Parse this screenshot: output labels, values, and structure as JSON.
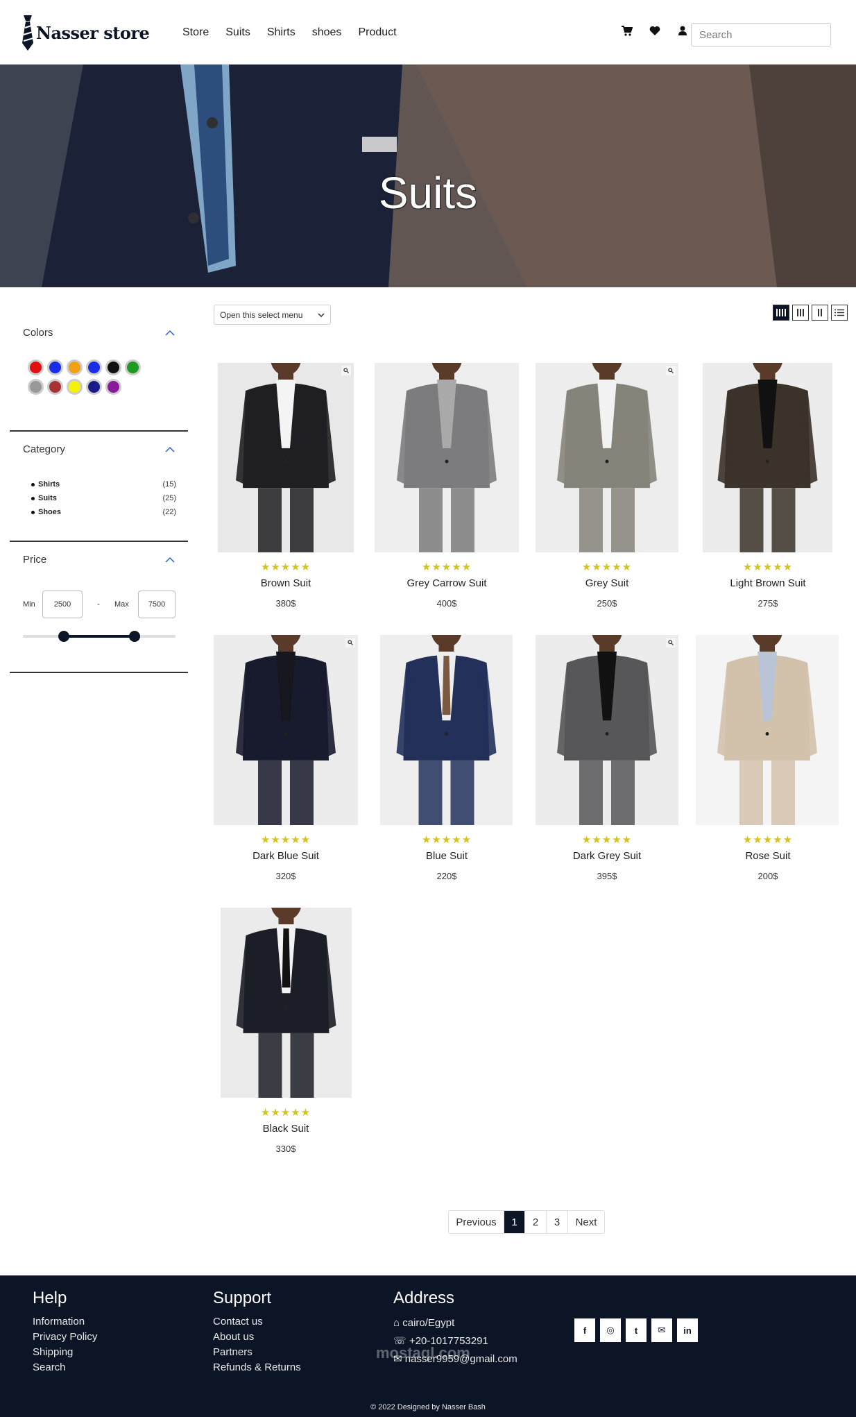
{
  "header": {
    "brand": "Nasser store",
    "nav": [
      "Store",
      "Suits",
      "Shirts",
      "shoes",
      "Product"
    ],
    "search_placeholder": "Search",
    "icons": [
      "cart-icon",
      "heart-icon",
      "user-icon"
    ]
  },
  "hero": {
    "title": "Suits"
  },
  "sidebar": {
    "colors_title": "Colors",
    "colors": [
      "#e01010",
      "#1a2ee8",
      "#f0a010",
      "#1a2ee8",
      "#111111",
      "#1e9a1e",
      "#999999",
      "#a83232",
      "#f4f400",
      "#1a1a8a",
      "#8a1a9a"
    ],
    "category_title": "Category",
    "categories": [
      {
        "name": "Shirts",
        "count": "(15)"
      },
      {
        "name": "Suits",
        "count": "(25)"
      },
      {
        "name": "Shoes",
        "count": "(22)"
      }
    ],
    "price_title": "Price",
    "price": {
      "min_label": "Min",
      "min": "2500",
      "sep": "-",
      "max_label": "Max",
      "max": "7500",
      "slider_low": 0.27,
      "slider_high": 0.73
    }
  },
  "toolbar": {
    "select_label": "Open this select menu"
  },
  "products": [
    {
      "name": "Brown Suit",
      "price": "380$",
      "stars": "★★★★★",
      "suit": "#1f1e22",
      "shirt": "#f4f4f4",
      "tie": "",
      "bg": "#e8e8e8"
    },
    {
      "name": "Grey Carrow Suit",
      "price": "400$",
      "stars": "★★★★★",
      "suit": "#7c7b7d",
      "shirt": "#a9a9a9",
      "tie": "",
      "bg": "#eeeeee"
    },
    {
      "name": "Grey Suit",
      "price": "250$",
      "stars": "★★★★★",
      "suit": "#86837a",
      "shirt": "#f2f2f2",
      "tie": "",
      "bg": "#ededed"
    },
    {
      "name": "Light Brown Suit",
      "price": "275$",
      "stars": "★★★★★",
      "suit": "#3b3229",
      "shirt": "#111111",
      "tie": "",
      "bg": "#ececec"
    },
    {
      "name": "Dark Blue Suit",
      "price": "320$",
      "stars": "★★★★★",
      "suit": "#181a2d",
      "shirt": "#15161e",
      "tie": "",
      "bg": "#ececec"
    },
    {
      "name": "Blue Suit",
      "price": "220$",
      "stars": "★★★★★",
      "suit": "#22305a",
      "shirt": "#eeeeee",
      "tie": "#7a5a40",
      "bg": "#eeeeee"
    },
    {
      "name": "Dark Grey Suit",
      "price": "395$",
      "stars": "★★★★★",
      "suit": "#575759",
      "shirt": "#111111",
      "tie": "",
      "bg": "#ececec"
    },
    {
      "name": "Rose Suit",
      "price": "200$",
      "stars": "★★★★★",
      "suit": "#d2c2ac",
      "shirt": "#b9c4d6",
      "tie": "",
      "bg": "#f4f4f4"
    },
    {
      "name": "Black Suit",
      "price": "330$",
      "stars": "★★★★★",
      "suit": "#1b1e26",
      "shirt": "#f2f2f2",
      "tie": "#111111",
      "bg": "#ebebeb"
    }
  ],
  "pagination": [
    "Previous",
    "1",
    "2",
    "3",
    "Next"
  ],
  "footer": {
    "help_title": "Help",
    "help_links": [
      "Information",
      "Privacy Policy",
      "Shipping",
      "Search"
    ],
    "support_title": "Support",
    "support_links": [
      "Contact us",
      "About us",
      "Partners",
      "Refunds & Returns"
    ],
    "address_title": "Address",
    "address_lines": [
      "cairo/Egypt",
      "+20-1017753291",
      "nasser9959@gmail.com"
    ],
    "social": [
      "f",
      "◎",
      "t",
      "✉",
      "in"
    ],
    "watermark": "mostaql.com",
    "copyright": "© 2022 Designed by Nasser Bash"
  },
  "colors": {
    "navy": "#0c1526",
    "star": "#d4c31d"
  }
}
